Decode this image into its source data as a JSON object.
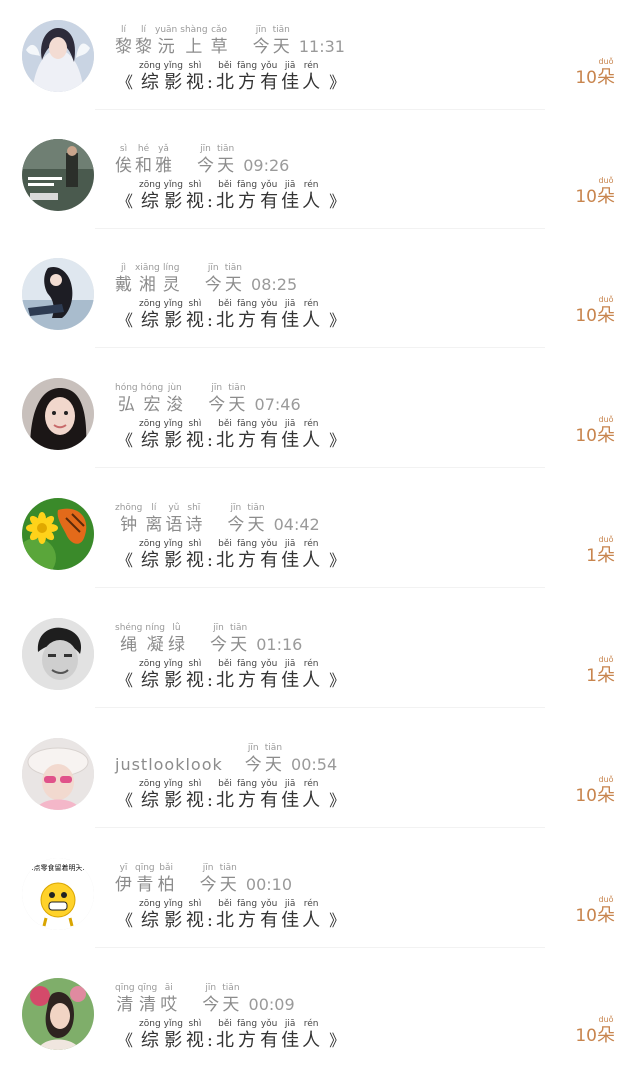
{
  "gift": {
    "bracket_left": "《",
    "bracket_right": "》",
    "chars": [
      {
        "py": "zōng",
        "hz": "综"
      },
      {
        "py": "yǐng",
        "hz": "影"
      },
      {
        "py": "shì",
        "hz": "视"
      },
      {
        "py": "",
        "hz": ":"
      },
      {
        "py": "běi",
        "hz": "北"
      },
      {
        "py": "fāng",
        "hz": "方"
      },
      {
        "py": "yǒu",
        "hz": "有"
      },
      {
        "py": "jiā",
        "hz": "佳"
      },
      {
        "py": "rén",
        "hz": "人"
      }
    ]
  },
  "day": {
    "chars": [
      {
        "py": "jīn",
        "hz": "今"
      },
      {
        "py": "tiān",
        "hz": "天"
      }
    ]
  },
  "unit": {
    "py": "duǒ",
    "hz": "朵"
  },
  "items": [
    {
      "name_chars": [
        {
          "py": "lí",
          "hz": "黎"
        },
        {
          "py": "lí",
          "hz": "黎"
        },
        {
          "py": "yuān",
          "hz": "沅"
        },
        {
          "py": "shàng",
          "hz": "上"
        },
        {
          "py": "cǎo",
          "hz": "草"
        }
      ],
      "time": "11:31",
      "count": "10",
      "avatar": "avatar-fantasy-girl"
    },
    {
      "name_chars": [
        {
          "py": "sì",
          "hz": "俟"
        },
        {
          "py": "hé",
          "hz": "和"
        },
        {
          "py": "yǎ",
          "hz": "雅"
        }
      ],
      "time": "09:26",
      "count": "10",
      "avatar": "avatar-outdoor-poster"
    },
    {
      "name_chars": [
        {
          "py": "jì",
          "hz": "戴"
        },
        {
          "py": "xiāng",
          "hz": "湘"
        },
        {
          "py": "líng",
          "hz": "灵"
        }
      ],
      "time": "08:25",
      "count": "10",
      "avatar": "avatar-sitting-girl"
    },
    {
      "name_chars": [
        {
          "py": "hóng",
          "hz": "弘"
        },
        {
          "py": "hóng",
          "hz": "宏"
        },
        {
          "py": "jùn",
          "hz": "浚"
        }
      ],
      "time": "07:46",
      "count": "10",
      "avatar": "avatar-selfie-woman"
    },
    {
      "name_chars": [
        {
          "py": "zhōng",
          "hz": "钟"
        },
        {
          "py": "lí",
          "hz": "离"
        },
        {
          "py": "yǔ",
          "hz": "语"
        },
        {
          "py": "shī",
          "hz": "诗"
        }
      ],
      "time": "04:42",
      "count": "1",
      "avatar": "avatar-butterfly-flower"
    },
    {
      "name_chars": [
        {
          "py": "shéng",
          "hz": "绳"
        },
        {
          "py": "níng",
          "hz": "凝"
        },
        {
          "py": "lǜ",
          "hz": "绿"
        }
      ],
      "time": "01:16",
      "count": "1",
      "avatar": "avatar-bw-man"
    },
    {
      "name_latin": "justlooklook",
      "time": "00:54",
      "count": "10",
      "avatar": "avatar-child-sunglasses"
    },
    {
      "name_chars": [
        {
          "py": "yī",
          "hz": "伊"
        },
        {
          "py": "qīng",
          "hz": "青"
        },
        {
          "py": "bǎi",
          "hz": "柏"
        }
      ],
      "time": "00:10",
      "count": "10",
      "avatar": "avatar-emoji-meme",
      "avatar_text": ".点零食留着明天."
    },
    {
      "name_chars": [
        {
          "py": "qīng",
          "hz": "清"
        },
        {
          "py": "qīng",
          "hz": "清"
        },
        {
          "py": "āi",
          "hz": "哎"
        }
      ],
      "time": "00:09",
      "count": "10",
      "avatar": "avatar-flower-girl"
    }
  ]
}
